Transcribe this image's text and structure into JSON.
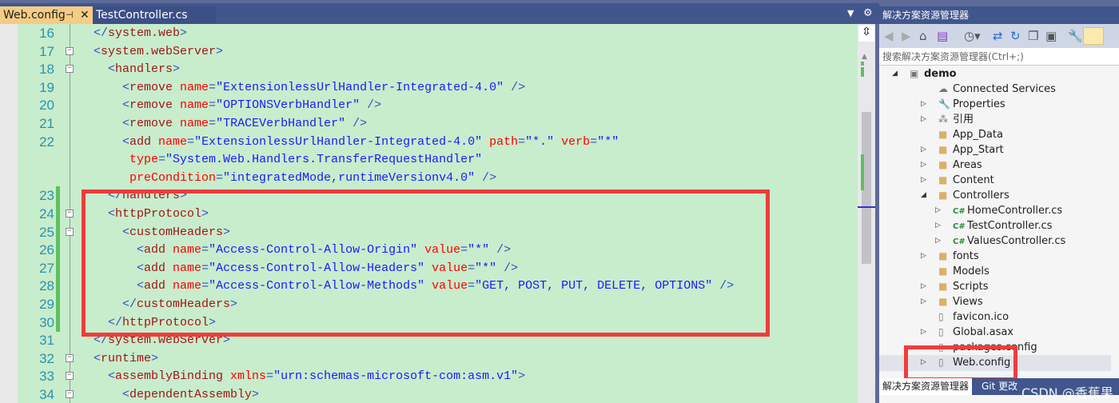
{
  "tabs": [
    {
      "label": "Web.config",
      "active": true,
      "pin": "⊣",
      "close": "✕"
    },
    {
      "label": "TestController.cs",
      "active": false
    }
  ],
  "colors": {
    "background": "#c7edcc",
    "line_number": "#2b91af",
    "bracket": "#3050c8",
    "tag": "#a31515",
    "attribute": "#ff0000",
    "value": "#1a1aff",
    "highlight_box": "#f23b3b"
  },
  "editor": {
    "lines": [
      {
        "num": "16",
        "fold": "",
        "tokens": [
          [
            "b",
            "    </"
          ],
          [
            "t",
            "system.web"
          ],
          [
            "b",
            ">"
          ]
        ]
      },
      {
        "num": "17",
        "fold": "−",
        "tokens": [
          [
            "b",
            "    <"
          ],
          [
            "t",
            "system.webServer"
          ],
          [
            "b",
            ">"
          ]
        ]
      },
      {
        "num": "18",
        "fold": "−",
        "tokens": [
          [
            "b",
            "      <"
          ],
          [
            "t",
            "handlers"
          ],
          [
            "b",
            ">"
          ]
        ]
      },
      {
        "num": "19",
        "fold": "",
        "tokens": [
          [
            "b",
            "        <"
          ],
          [
            "t",
            "remove "
          ],
          [
            "a",
            "name"
          ],
          [
            "b",
            "="
          ],
          [
            "v",
            "\"ExtensionlessUrlHandler-Integrated-4.0\""
          ],
          [
            "b",
            " />"
          ]
        ]
      },
      {
        "num": "20",
        "fold": "",
        "tokens": [
          [
            "b",
            "        <"
          ],
          [
            "t",
            "remove "
          ],
          [
            "a",
            "name"
          ],
          [
            "b",
            "="
          ],
          [
            "v",
            "\"OPTIONSVerbHandler\""
          ],
          [
            "b",
            " />"
          ]
        ]
      },
      {
        "num": "21",
        "fold": "",
        "tokens": [
          [
            "b",
            "        <"
          ],
          [
            "t",
            "remove "
          ],
          [
            "a",
            "name"
          ],
          [
            "b",
            "="
          ],
          [
            "v",
            "\"TRACEVerbHandler\""
          ],
          [
            "b",
            " />"
          ]
        ]
      },
      {
        "num": "22",
        "fold": "",
        "tokens": [
          [
            "b",
            "        <"
          ],
          [
            "t",
            "add "
          ],
          [
            "a",
            "name"
          ],
          [
            "b",
            "="
          ],
          [
            "v",
            "\"ExtensionlessUrlHandler-Integrated-4.0\""
          ],
          [
            "a",
            " path"
          ],
          [
            "b",
            "="
          ],
          [
            "v",
            "\"*.\""
          ],
          [
            "a",
            " verb"
          ],
          [
            "b",
            "="
          ],
          [
            "v",
            "\"*\""
          ]
        ]
      },
      {
        "num": "",
        "fold": "",
        "tokens": [
          [
            "a",
            "         type"
          ],
          [
            "b",
            "="
          ],
          [
            "v",
            "\"System.Web.Handlers.TransferRequestHandler\""
          ]
        ]
      },
      {
        "num": "",
        "fold": "",
        "tokens": [
          [
            "a",
            "         preCondition"
          ],
          [
            "b",
            "="
          ],
          [
            "v",
            "\"integratedMode,runtimeVersionv4.0\""
          ],
          [
            "b",
            " />"
          ]
        ]
      },
      {
        "num": "23",
        "fold": "",
        "changed": true,
        "tokens": [
          [
            "b",
            "      </"
          ],
          [
            "t",
            "handlers"
          ],
          [
            "b",
            ">"
          ]
        ]
      },
      {
        "num": "24",
        "fold": "−",
        "changed": true,
        "tokens": [
          [
            "b",
            "      <"
          ],
          [
            "t",
            "httpProtocol"
          ],
          [
            "b",
            ">"
          ]
        ]
      },
      {
        "num": "25",
        "fold": "−",
        "changed": true,
        "tokens": [
          [
            "b",
            "        <"
          ],
          [
            "t",
            "customHeaders"
          ],
          [
            "b",
            ">"
          ]
        ]
      },
      {
        "num": "26",
        "fold": "",
        "changed": true,
        "tokens": [
          [
            "b",
            "          <"
          ],
          [
            "t",
            "add "
          ],
          [
            "a",
            "name"
          ],
          [
            "b",
            "="
          ],
          [
            "v",
            "\"Access-Control-Allow-Origin\""
          ],
          [
            "a",
            " value"
          ],
          [
            "b",
            "="
          ],
          [
            "v",
            "\"*\""
          ],
          [
            "b",
            " />"
          ]
        ]
      },
      {
        "num": "27",
        "fold": "",
        "changed": true,
        "tokens": [
          [
            "b",
            "          <"
          ],
          [
            "t",
            "add "
          ],
          [
            "a",
            "name"
          ],
          [
            "b",
            "="
          ],
          [
            "v",
            "\"Access-Control-Allow-Headers\""
          ],
          [
            "a",
            " value"
          ],
          [
            "b",
            "="
          ],
          [
            "v",
            "\"*\""
          ],
          [
            "b",
            " />"
          ]
        ]
      },
      {
        "num": "28",
        "fold": "",
        "changed": true,
        "tokens": [
          [
            "b",
            "          <"
          ],
          [
            "t",
            "add "
          ],
          [
            "a",
            "name"
          ],
          [
            "b",
            "="
          ],
          [
            "v",
            "\"Access-Control-Allow-Methods\""
          ],
          [
            "a",
            " value"
          ],
          [
            "b",
            "="
          ],
          [
            "v",
            "\"GET, POST, PUT, DELETE, OPTIONS\""
          ],
          [
            "b",
            " />"
          ]
        ]
      },
      {
        "num": "29",
        "fold": "",
        "changed": true,
        "tokens": [
          [
            "b",
            "        </"
          ],
          [
            "t",
            "customHeaders"
          ],
          [
            "b",
            ">"
          ]
        ]
      },
      {
        "num": "30",
        "fold": "",
        "changed": true,
        "tokens": [
          [
            "b",
            "      </"
          ],
          [
            "t",
            "httpProtocol"
          ],
          [
            "b",
            ">"
          ]
        ]
      },
      {
        "num": "31",
        "fold": "",
        "tokens": [
          [
            "b",
            "    </"
          ],
          [
            "t",
            "system.webServer"
          ],
          [
            "b",
            ">"
          ]
        ]
      },
      {
        "num": "32",
        "fold": "−",
        "tokens": [
          [
            "b",
            "    <"
          ],
          [
            "t",
            "runtime"
          ],
          [
            "b",
            ">"
          ]
        ]
      },
      {
        "num": "33",
        "fold": "−",
        "tokens": [
          [
            "b",
            "      <"
          ],
          [
            "t",
            "assemblyBinding "
          ],
          [
            "a",
            "xmlns"
          ],
          [
            "b",
            "="
          ],
          [
            "v",
            "\"urn:schemas-microsoft-com:asm.v1\""
          ],
          [
            "b",
            ">"
          ]
        ]
      },
      {
        "num": "34",
        "fold": "−",
        "tokens": [
          [
            "b",
            "        <"
          ],
          [
            "t",
            "dependentAssembly"
          ],
          [
            "b",
            ">"
          ]
        ]
      }
    ]
  },
  "solution_explorer": {
    "title": "解决方案资源管理器",
    "search_placeholder": "搜索解决方案资源管理器(Ctrl+;)",
    "items": [
      {
        "label": "demo",
        "level": 0,
        "arrow": "◢",
        "icon": "project-icon",
        "glyph": "▣",
        "bold": true
      },
      {
        "label": "Connected Services",
        "level": 1,
        "arrow": "",
        "icon": "cloud-icon",
        "glyph": "☁"
      },
      {
        "label": "Properties",
        "level": 1,
        "arrow": "▷",
        "icon": "wrench-icon",
        "glyph": "🔧"
      },
      {
        "label": "引用",
        "level": 1,
        "arrow": "▷",
        "icon": "references-icon",
        "glyph": "⁂"
      },
      {
        "label": "App_Data",
        "level": 1,
        "arrow": "",
        "icon": "folder-icon",
        "glyph": "■"
      },
      {
        "label": "App_Start",
        "level": 1,
        "arrow": "▷",
        "icon": "folder-icon",
        "glyph": "■"
      },
      {
        "label": "Areas",
        "level": 1,
        "arrow": "▷",
        "icon": "folder-icon",
        "glyph": "■"
      },
      {
        "label": "Content",
        "level": 1,
        "arrow": "▷",
        "icon": "folder-icon",
        "glyph": "■"
      },
      {
        "label": "Controllers",
        "level": 1,
        "arrow": "◢",
        "icon": "folder-open-icon",
        "glyph": "■"
      },
      {
        "label": "HomeController.cs",
        "level": 2,
        "arrow": "▷",
        "icon": "csharp-file-icon",
        "glyph": "C#"
      },
      {
        "label": "TestController.cs",
        "level": 2,
        "arrow": "▷",
        "icon": "csharp-file-icon",
        "glyph": "C#"
      },
      {
        "label": "ValuesController.cs",
        "level": 2,
        "arrow": "▷",
        "icon": "csharp-file-icon",
        "glyph": "C#"
      },
      {
        "label": "fonts",
        "level": 1,
        "arrow": "▷",
        "icon": "folder-icon",
        "glyph": "■"
      },
      {
        "label": "Models",
        "level": 1,
        "arrow": "",
        "icon": "folder-icon",
        "glyph": "■"
      },
      {
        "label": "Scripts",
        "level": 1,
        "arrow": "▷",
        "icon": "folder-icon",
        "glyph": "■"
      },
      {
        "label": "Views",
        "level": 1,
        "arrow": "▷",
        "icon": "folder-icon",
        "glyph": "■"
      },
      {
        "label": "favicon.ico",
        "level": 1,
        "arrow": "",
        "icon": "file-icon",
        "glyph": "▯"
      },
      {
        "label": "Global.asax",
        "level": 1,
        "arrow": "▷",
        "icon": "file-gear-icon",
        "glyph": "▯"
      },
      {
        "label": "packages.config",
        "level": 1,
        "arrow": "",
        "icon": "file-icon",
        "glyph": "▯"
      },
      {
        "label": "Web.config",
        "level": 1,
        "arrow": "▷",
        "icon": "config-file-icon",
        "glyph": "▯",
        "selected": true
      }
    ],
    "bottom_tabs": [
      "解决方案资源管理器",
      "Git 更改"
    ]
  },
  "watermark": "CSDN @香蕉果"
}
